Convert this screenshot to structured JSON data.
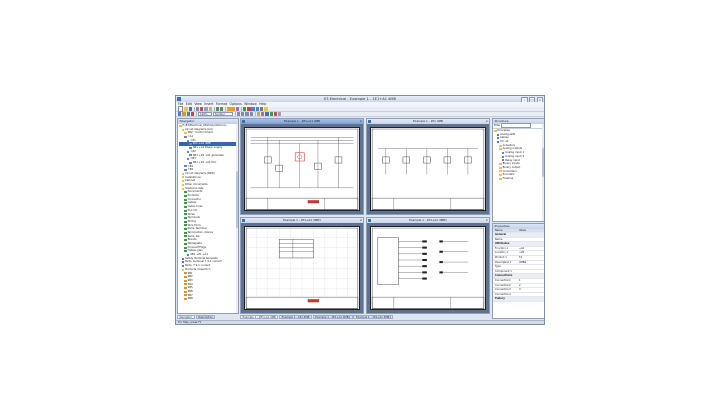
{
  "window": {
    "title": "E3 Electrical - Example 1 - 1E1+A1 4MB"
  },
  "menu": [
    "File",
    "Edit",
    "View",
    "Insert",
    "Format",
    "Options",
    "Window",
    "Help"
  ],
  "toolbar": {
    "zoom": "100%",
    "scope": "Symbol"
  },
  "navigator": {
    "title": "Navigator",
    "items": [
      {
        "label": "E:\\E3\\Electrical_05\\ProductsDocs\\...",
        "icon": "folder",
        "indent": 0
      },
      {
        "label": "Circuit diagrams (Cd)",
        "icon": "folder",
        "indent": 1
      },
      {
        "label": "SB2 : Control board",
        "icon": "folder",
        "indent": 2
      },
      {
        "label": "=A1",
        "icon": "page",
        "indent": 2
      },
      {
        "label": "=Z1",
        "icon": "page",
        "indent": 3
      },
      {
        "label": "1E1 +A1 4MB",
        "icon": "page",
        "indent": 4,
        "selected": true
      },
      {
        "label": "SB1 +A1 Power supply",
        "icon": "page",
        "indent": 4
      },
      {
        "label": "=Z2",
        "icon": "page",
        "indent": 3
      },
      {
        "label": "SB1 +Z2 +A1 generator",
        "icon": "page",
        "indent": 4
      },
      {
        "label": "=B3",
        "icon": "page",
        "indent": 3
      },
      {
        "label": "SB1 +Z1 +A1 PLC",
        "icon": "page",
        "indent": 4
      },
      {
        "label": "=B1",
        "icon": "page",
        "indent": 2
      },
      {
        "label": "=B2",
        "icon": "page",
        "indent": 2
      },
      {
        "label": "Circuit diagrams (BRD)",
        "icon": "folder",
        "indent": 1
      },
      {
        "label": "Installations",
        "icon": "folder",
        "indent": 1
      },
      {
        "label": "Cabinet",
        "icon": "folder",
        "indent": 1
      },
      {
        "label": "Other documents",
        "icon": "folder",
        "indent": 1
      },
      {
        "label": "Graphical lists",
        "icon": "folder",
        "indent": 1
      },
      {
        "label": "Documents",
        "icon": "green",
        "indent": 2
      },
      {
        "label": "Products",
        "icon": "green",
        "indent": 2
      },
      {
        "label": "Connector",
        "icon": "green",
        "indent": 2
      },
      {
        "label": "Cables",
        "icon": "green",
        "indent": 2
      },
      {
        "label": "Cable cross",
        "icon": "green",
        "indent": 2
      },
      {
        "label": "PLC I/O",
        "icon": "green",
        "indent": 2
      },
      {
        "label": "Wires",
        "icon": "green",
        "indent": 2
      },
      {
        "label": "Terminals",
        "icon": "green",
        "indent": 2
      },
      {
        "label": "Wiring",
        "icon": "green",
        "indent": 2
      },
      {
        "label": "Wire Form",
        "icon": "green",
        "indent": 2
      },
      {
        "label": "Parts, terminal",
        "icon": "green",
        "indent": 2
      },
      {
        "label": "Terminatoin, device",
        "icon": "green",
        "indent": 2
      },
      {
        "label": "Parts, list",
        "icon": "green",
        "indent": 2
      },
      {
        "label": "Brands",
        "icon": "green",
        "indent": 2
      },
      {
        "label": "Nameplate",
        "icon": "green",
        "indent": 2
      },
      {
        "label": "Connect/Flags",
        "icon": "green",
        "indent": 2
      },
      {
        "label": "Cables plan",
        "icon": "green",
        "indent": 2
      },
      {
        "label": "SB1 +Z1 +A1",
        "icon": "blue",
        "indent": 3
      },
      {
        "label": "Safety Terminal template",
        "icon": "blue",
        "indent": 1
      },
      {
        "label": "Parts, terminal 7 9-1 current",
        "icon": "blue",
        "indent": 1
      },
      {
        "label": "Parts, 7 9-1 current",
        "icon": "blue",
        "indent": 1
      },
      {
        "label": "Products Inspection",
        "icon": "folder",
        "indent": 1
      },
      {
        "label": "SB1",
        "icon": "orange",
        "indent": 2
      },
      {
        "label": "SB2",
        "icon": "orange",
        "indent": 2
      },
      {
        "label": "SB3",
        "icon": "orange",
        "indent": 2
      },
      {
        "label": "SB4",
        "icon": "orange",
        "indent": 2
      },
      {
        "label": "SB5",
        "icon": "orange",
        "indent": 2
      },
      {
        "label": "SB6",
        "icon": "orange",
        "indent": 2
      },
      {
        "label": "SB7",
        "icon": "orange",
        "indent": 2
      },
      {
        "label": "SB8",
        "icon": "orange",
        "indent": 2
      }
    ]
  },
  "docs": [
    {
      "title": "Example 1 - 1E1+A1 4MB",
      "active": true
    },
    {
      "title": "Example 1 - 1E1 4MB",
      "active": false
    },
    {
      "title": "Example 1 - 1E1+A1 4MB1",
      "active": false
    },
    {
      "title": "Example 1 - 1E1+A1 4MB1",
      "active": false
    }
  ],
  "bottom_tabs_left": [
    "Navigator",
    "Description"
  ],
  "bottom_tabs_docs": [
    "Example 1 - 1E1+A1 4MB",
    "Example 1 - 1E1 4MB",
    "Example 1 - 1E1+A1 4MB1",
    "Example 1 - 1E1+A1 4MB1"
  ],
  "structure": {
    "title": "Structure",
    "filter_label": "Filter",
    "items": [
      {
        "label": "Principles",
        "icon": "folder",
        "indent": 0
      },
      {
        "label": "AnalogueIN",
        "icon": "blue",
        "indent": 1
      },
      {
        "label": "Cables",
        "icon": "blue",
        "indent": 1
      },
      {
        "label": "I/O, all",
        "icon": "blue",
        "indent": 1
      },
      {
        "label": "Actuators",
        "icon": "folder",
        "indent": 2
      },
      {
        "label": "Analog outputs",
        "icon": "folder",
        "indent": 2
      },
      {
        "label": "Analog input 1",
        "icon": "page",
        "indent": 3
      },
      {
        "label": "Analog input 2",
        "icon": "page",
        "indent": 3
      },
      {
        "label": "Relay input",
        "icon": "page",
        "indent": 3
      },
      {
        "label": "Binary inputs",
        "icon": "folder",
        "indent": 2
      },
      {
        "label": "Binary output",
        "icon": "folder",
        "indent": 2
      },
      {
        "label": "Controllers",
        "icon": "folder",
        "indent": 2
      },
      {
        "label": "Encoders",
        "icon": "folder",
        "indent": 2
      },
      {
        "label": "Flowline",
        "icon": "folder",
        "indent": 2
      }
    ]
  },
  "properties": {
    "title": "Properties",
    "header": {
      "name": "Name",
      "value": "Value"
    },
    "rows": [
      {
        "k": "General",
        "v": "",
        "group": true
      },
      {
        "k": "Name",
        "v": ""
      },
      {
        "k": "Attributes",
        "v": "",
        "group": true
      },
      {
        "k": "Function 1",
        "v": "+A1"
      },
      {
        "k": "Location 1",
        "v": "+Z2"
      },
      {
        "k": "Product 1",
        "v": "T4"
      },
      {
        "k": "Description 1",
        "v": "4MB4"
      },
      {
        "k": "Type",
        "v": ""
      },
      {
        "k": "Component 1",
        "v": ""
      },
      {
        "k": "Connections",
        "v": "",
        "group": true
      },
      {
        "k": "Connection1",
        "v": "1"
      },
      {
        "k": "Connection2",
        "v": "2"
      },
      {
        "k": "Connection3",
        "v": "3"
      },
      {
        "k": "Connection4",
        "v": ""
      },
      {
        "k": "Pollery",
        "v": "",
        "group": true
      }
    ]
  },
  "status": "For Help, press F1"
}
